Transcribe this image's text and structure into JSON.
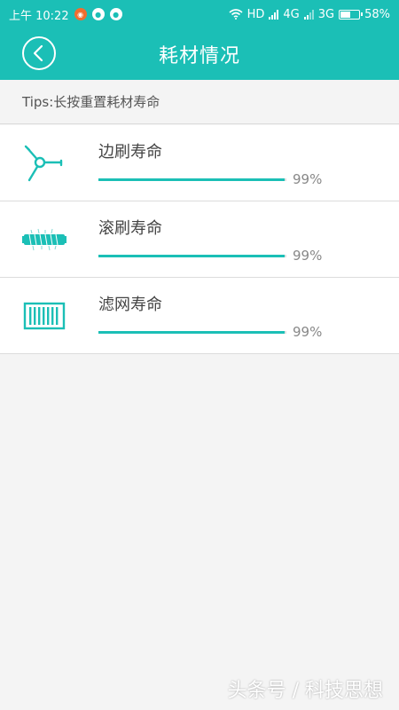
{
  "status_bar": {
    "time": "上午 10:22",
    "network_hd": "HD",
    "network_4g": "4G",
    "network_3g": "3G",
    "battery": "58%",
    "battery_level": 0.58
  },
  "header": {
    "title": "耗材情况",
    "back_icon": "chevron-left-circle-icon"
  },
  "tips": {
    "text": "Tips:长按重置耗材寿命"
  },
  "items": [
    {
      "label": "边刷寿命",
      "percent_text": "99%",
      "percent": 0.99,
      "icon": "side-brush-icon"
    },
    {
      "label": "滚刷寿命",
      "percent_text": "99%",
      "percent": 0.99,
      "icon": "roller-brush-icon"
    },
    {
      "label": "滤网寿命",
      "percent_text": "99%",
      "percent": 0.99,
      "icon": "filter-icon"
    }
  ],
  "watermark": "头条号 / 科技思想",
  "colors": {
    "accent": "#1bbfb6",
    "background": "#f4f4f4"
  }
}
